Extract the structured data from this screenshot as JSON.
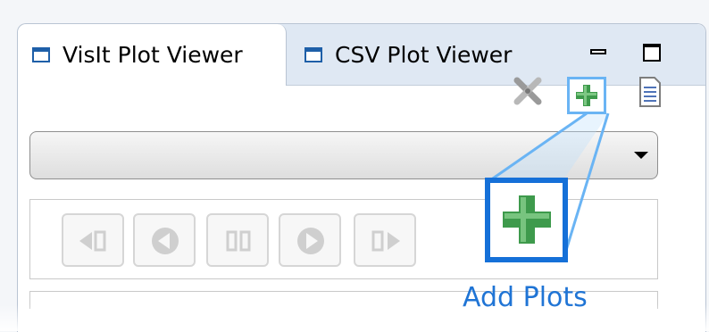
{
  "tabs": [
    {
      "label": "VisIt Plot Viewer",
      "icon": "window-icon",
      "active": true
    },
    {
      "label": "CSV Plot Viewer",
      "icon": "window-icon",
      "active": false
    }
  ],
  "window_controls": {
    "minimize": "minimize-icon",
    "maximize": "maximize-icon"
  },
  "toolbar": {
    "remove_icon": "remove-plot-icon",
    "add_icon": "add-plot-icon",
    "page_icon": "document-icon"
  },
  "plot_selector": {
    "selected": ""
  },
  "player_controls": [
    "step-back-icon",
    "play-back-icon",
    "pause-icon",
    "play-forward-icon",
    "step-forward-icon"
  ],
  "callout": {
    "label": "Add Plots",
    "highlight_color": "#1570d8",
    "line_color": "#6ab4f4"
  },
  "colors": {
    "tab_bar": "#dfe8f3",
    "accent_green": "#3e9a4c"
  }
}
